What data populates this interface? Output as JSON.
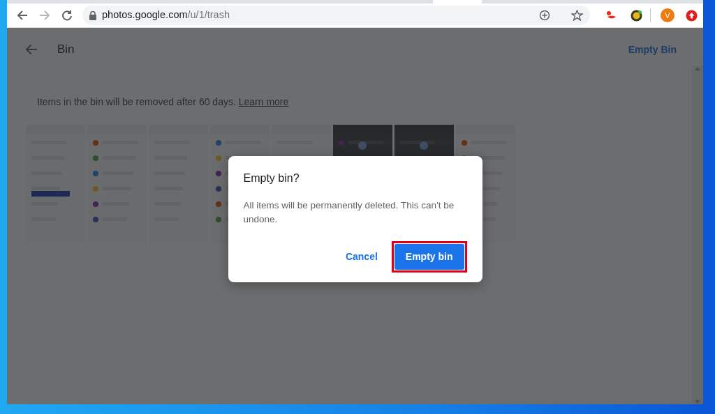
{
  "browser": {
    "back_disabled": false,
    "forward_disabled": true,
    "url": {
      "host": "photos.google.com",
      "path": "/u/1/trash"
    },
    "avatar_letter": "V"
  },
  "header": {
    "title": "Bin",
    "action": "Empty Bin"
  },
  "notice": {
    "text": "Items in the bin will be removed after 60 days.",
    "link": "Learn more"
  },
  "dialog": {
    "title": "Empty bin?",
    "message": "All items will be permanently deleted. This can't be undone.",
    "buttons": [
      {
        "label": "Cancel",
        "kind": "text",
        "highlighted": false
      },
      {
        "label": "Empty bin",
        "kind": "primary",
        "highlighted": true
      }
    ]
  }
}
